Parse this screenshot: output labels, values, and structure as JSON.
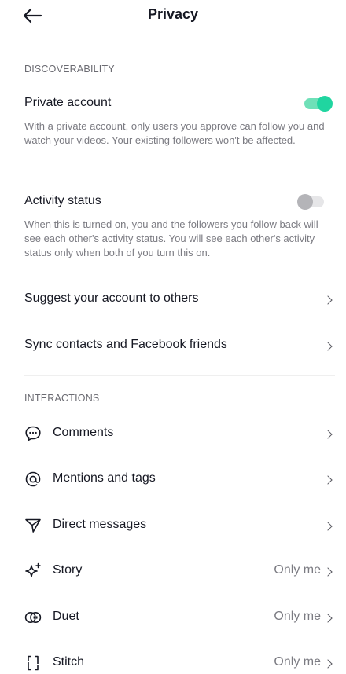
{
  "header": {
    "title": "Privacy"
  },
  "discoverability": {
    "label": "DISCOVERABILITY",
    "private_account": {
      "title": "Private account",
      "desc": "With a private account, only users you approve can follow you and watch your videos. Your existing followers won't be affected.",
      "enabled": true
    },
    "activity_status": {
      "title": "Activity status",
      "desc": "When this is turned on, you and the followers you follow back will see each other's activity status. You will see each other's activity status only when both of you turn this on.",
      "enabled": false
    },
    "suggest": {
      "title": "Suggest your account to others"
    },
    "sync": {
      "title": "Sync contacts and Facebook friends"
    }
  },
  "interactions": {
    "label": "INTERACTIONS",
    "items": [
      {
        "label": "Comments",
        "icon": "comment-icon",
        "value": ""
      },
      {
        "label": "Mentions and tags",
        "icon": "at-icon",
        "value": ""
      },
      {
        "label": "Direct messages",
        "icon": "send-icon",
        "value": ""
      },
      {
        "label": "Story",
        "icon": "sparkle-icon",
        "value": "Only me"
      },
      {
        "label": "Duet",
        "icon": "duet-icon",
        "value": "Only me"
      },
      {
        "label": "Stitch",
        "icon": "stitch-icon",
        "value": "Only me"
      }
    ]
  },
  "colors": {
    "toggle_on": "#20d5a0",
    "toggle_off": "#b4b4b8",
    "text": "#161823",
    "secondary": "#7b7b82"
  }
}
